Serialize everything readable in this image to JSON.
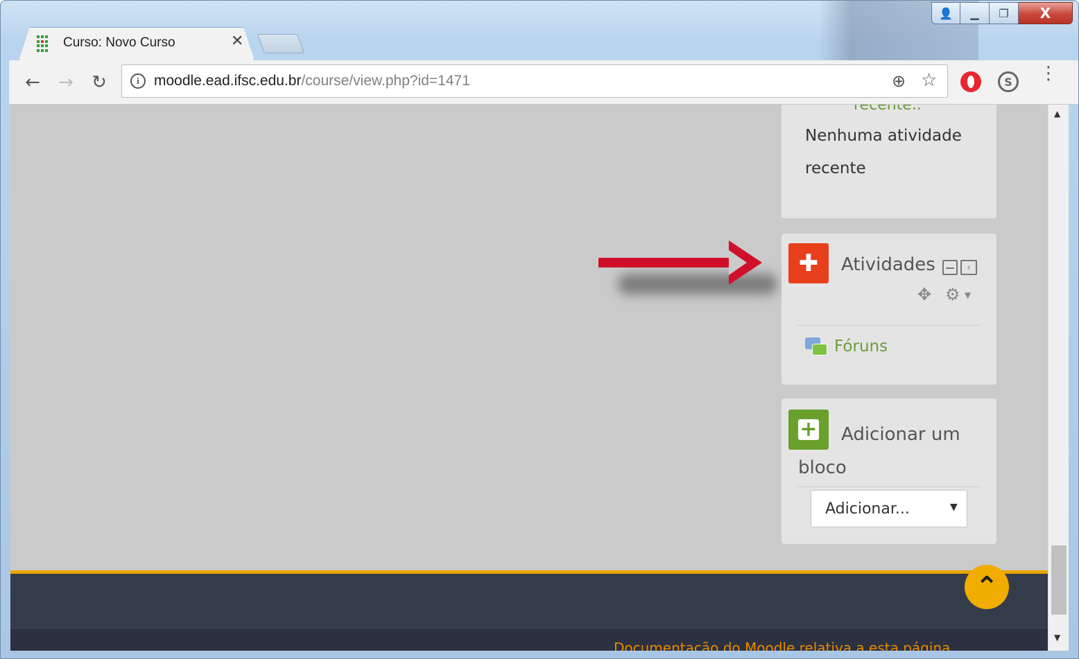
{
  "browser": {
    "tab_title": "Curso: Novo Curso",
    "tab_close": "✕",
    "url_host": "moodle.ead.ifsc.edu.br",
    "url_path": "/course/view.php?id=1471",
    "info_icon": "i",
    "back": "←",
    "forward": "→",
    "reload": "↻",
    "zoom_icon": "⊕",
    "star_icon": "☆",
    "menu_icon": "⋮",
    "shazam_glyph": "S",
    "window_controls": {
      "user": "👤",
      "minimize": "▁",
      "restore": "❐",
      "close": "X"
    }
  },
  "recent_block": {
    "link_text": "recente..",
    "empty_text": "Nenhuma atividade recente"
  },
  "activities_block": {
    "title": "Atividades",
    "icon_glyph": "✚",
    "dock_glyph": "‹",
    "move_glyph": "✥",
    "gear_glyph": "⚙",
    "caret_glyph": "▼",
    "items": [
      {
        "label": "Fóruns"
      }
    ]
  },
  "add_block": {
    "title": "Adicionar um bloco",
    "icon_glyph": "+",
    "select_value": "Adicionar...",
    "select_caret": "▼"
  },
  "footer": {
    "doc_link": "Documentação do Moodle relativa a esta página",
    "back_to_top_glyph": "⌃"
  },
  "scrollbar": {
    "up": "▲",
    "down": "▼"
  },
  "colors": {
    "activities_icon": "#e8401c",
    "add_icon": "#6aa02c",
    "link_green": "#6a9d3a",
    "footer_accent": "#e9a600",
    "arrow_red": "#d0102a"
  }
}
